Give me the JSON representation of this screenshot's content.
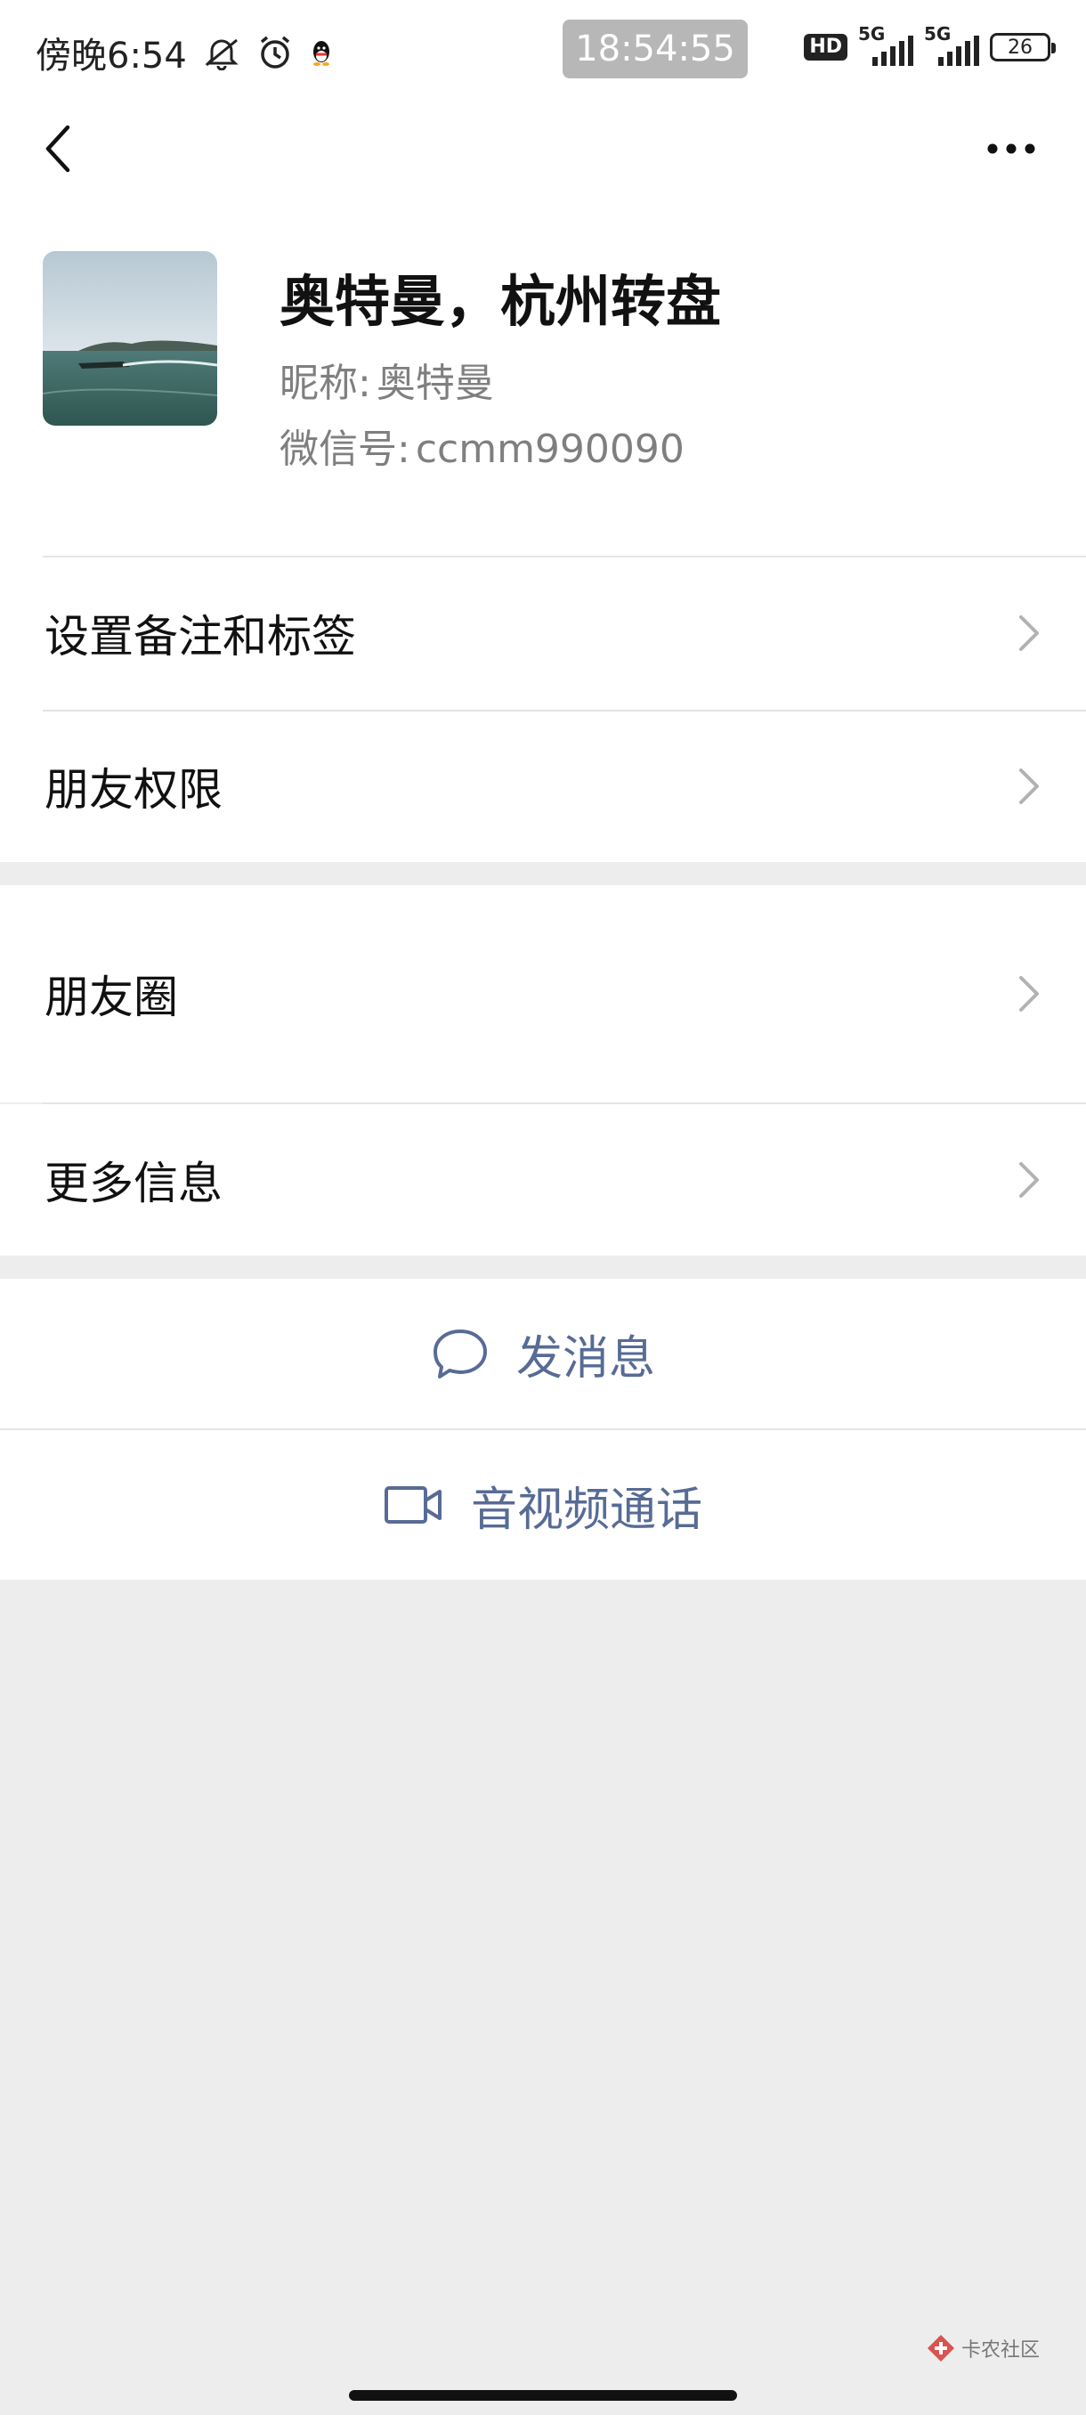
{
  "status_bar": {
    "left_time": "傍晚6:54",
    "center_time": "18:54:55",
    "hd_label": "HD",
    "network_1": "5G",
    "network_2": "5G",
    "battery": "26",
    "icons": [
      "mute-notification-icon",
      "alarm-icon",
      "qq-icon",
      "hd-icon",
      "signal-icon",
      "signal-icon",
      "battery-icon"
    ]
  },
  "nav": {
    "back_icon": "chevron-left-icon",
    "more_icon": "more-dots-icon"
  },
  "profile": {
    "display_name": "奥特曼，杭州转盘",
    "nickname_label": "昵称:",
    "nickname": "奥特曼",
    "wechat_id_label": "微信号:",
    "wechat_id": "ccmm990090"
  },
  "menu": {
    "set_remark": "设置备注和标签",
    "friend_permissions": "朋友权限",
    "moments": "朋友圈",
    "more_info": "更多信息"
  },
  "actions": {
    "send_message": "发消息",
    "av_call": "音视频通话"
  },
  "watermark": {
    "text": "卡农社区"
  },
  "colors": {
    "link_blue": "#576b95",
    "page_bg": "#ededed",
    "secondary_text": "#7f7f7f"
  }
}
